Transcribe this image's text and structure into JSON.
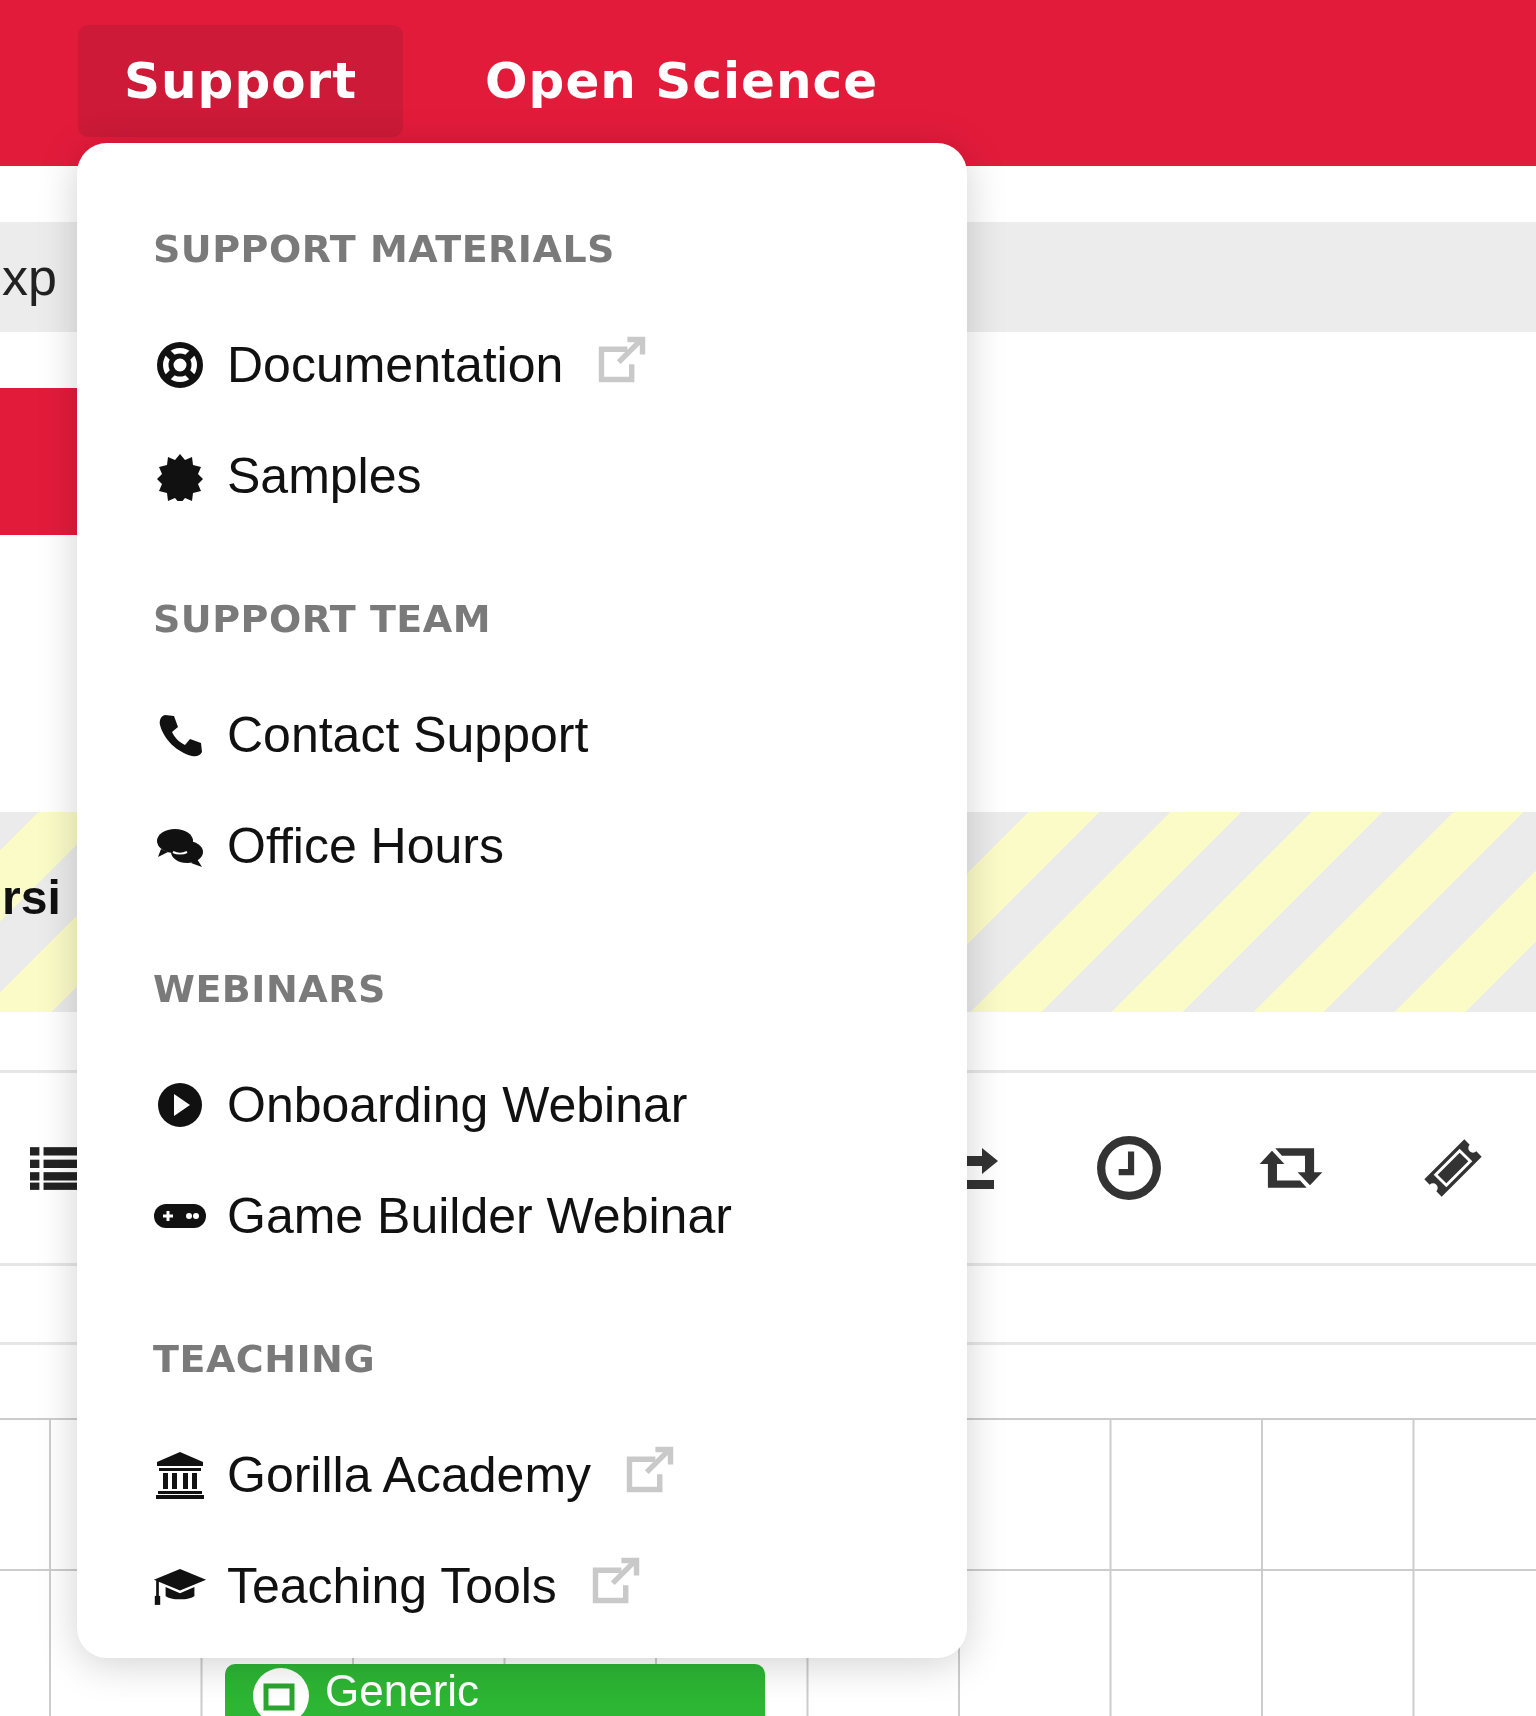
{
  "nav": {
    "tabs": [
      {
        "label": "Support",
        "selected": true
      },
      {
        "label": "Open Science",
        "selected": false
      }
    ]
  },
  "page": {
    "band_text": "xp",
    "banner_text": "rsi",
    "card_label": "Generic"
  },
  "dropdown": {
    "sections": [
      {
        "heading": "SUPPORT MATERIALS",
        "items": [
          {
            "label": "Documentation",
            "external": true
          },
          {
            "label": "Samples",
            "external": false
          }
        ]
      },
      {
        "heading": "SUPPORT TEAM",
        "items": [
          {
            "label": "Contact Support",
            "external": false
          },
          {
            "label": "Office Hours",
            "external": false
          }
        ]
      },
      {
        "heading": "WEBINARS",
        "items": [
          {
            "label": "Onboarding Webinar",
            "external": false
          },
          {
            "label": "Game Builder Webinar",
            "external": false
          }
        ]
      },
      {
        "heading": "TEACHING",
        "items": [
          {
            "label": "Gorilla Academy",
            "external": true
          },
          {
            "label": "Teaching Tools",
            "external": true
          }
        ]
      }
    ]
  }
}
